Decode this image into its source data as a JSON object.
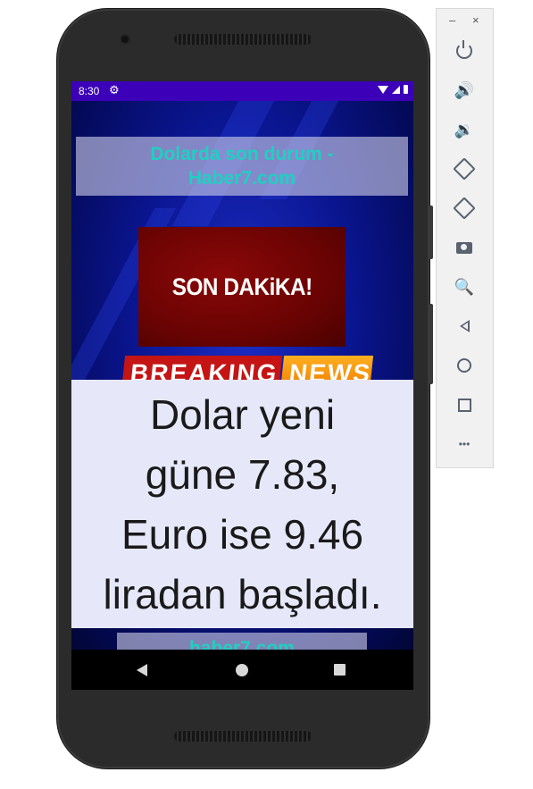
{
  "emulator": {
    "window_controls": {
      "minimize": "–",
      "close": "×"
    },
    "tools": [
      {
        "name": "power-icon"
      },
      {
        "name": "volume-up-icon",
        "glyph": "🔊"
      },
      {
        "name": "volume-down-icon",
        "glyph": "🔉"
      },
      {
        "name": "rotate-left-icon"
      },
      {
        "name": "rotate-right-icon"
      },
      {
        "name": "camera-icon"
      },
      {
        "name": "zoom-icon",
        "glyph": "🔍"
      },
      {
        "name": "back-icon"
      },
      {
        "name": "home-icon"
      },
      {
        "name": "overview-icon"
      },
      {
        "name": "more-icon",
        "glyph": "•••"
      }
    ]
  },
  "status_bar": {
    "time": "8:30",
    "gear": "⚙"
  },
  "app": {
    "headline_title": "Dolarda son durum - Haber7.com",
    "banner_text": "SON DAKiKA!",
    "breaking_text": "BREAKING",
    "news_text": "NEWS",
    "main_text": [
      "Dolar yeni",
      "güne 7.83,",
      "Euro ise 9.46",
      "liradan başladı."
    ],
    "footer_source": "haber7.com"
  },
  "colors": {
    "status_bar": "#3b00b8",
    "title_text": "#1fd0c0",
    "banner_red": "#6a0303",
    "main_box_bg": "#e6e8fa"
  }
}
